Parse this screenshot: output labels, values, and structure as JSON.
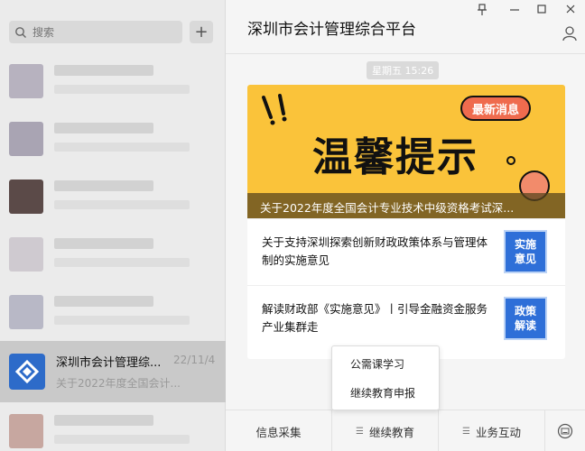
{
  "search": {
    "placeholder": "搜索",
    "add_label": "+"
  },
  "chats": {
    "blurred_colors": [
      "#b7b2bf",
      "#a9a4b3",
      "#5b4a48",
      "#cfcad0",
      "#b8b8c6",
      "#c7a7a0"
    ],
    "active": {
      "name": "深圳市会计管理综...",
      "date": "22/11/4",
      "preview": "关于2022年度全国会计..."
    }
  },
  "window": {
    "title": "深圳市会计管理综合平台",
    "pin_icon": "pin-icon",
    "minimize_icon": "minimize-icon",
    "maximize_icon": "maximize-icon",
    "close_icon": "close-icon"
  },
  "message": {
    "time": "星期五  15:26",
    "banner": {
      "heading": "温馨提示",
      "badge": "最新消息",
      "caption": "关于2022年度全国会计专业技术中级资格考试深...",
      "color": "#fac33a"
    },
    "news": [
      {
        "text": "关于支持深圳探索创新财政政策体系与管理体制的实施意见",
        "thumb_top": "实施",
        "thumb_bottom": "意见"
      },
      {
        "text": "解读财政部《实施意见》丨引导金融资金服务产业集群走",
        "thumb_top": "政策",
        "thumb_bottom": "解读"
      }
    ]
  },
  "popup": {
    "options": [
      "公需课学习",
      "继续教育申报"
    ]
  },
  "bottom_tabs": [
    "信息采集",
    "继续教育",
    "业务互动"
  ],
  "colors": {
    "accent": "#2e6fd8",
    "active_row": "#c9c9c9"
  }
}
